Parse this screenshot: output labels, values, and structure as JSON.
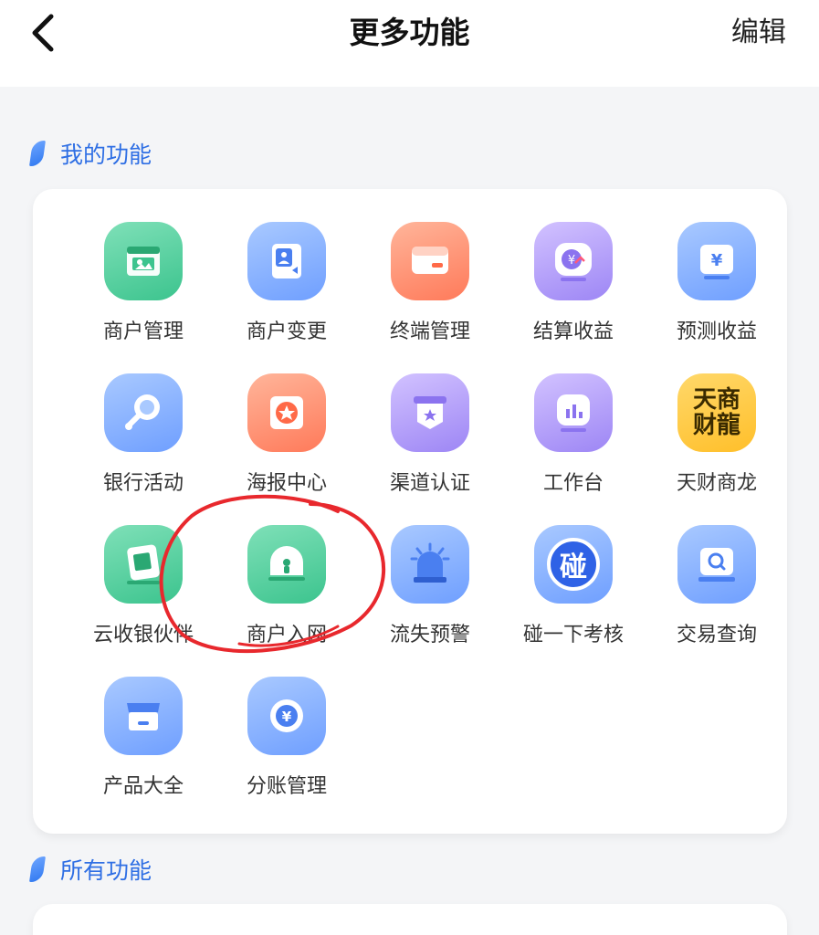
{
  "header": {
    "title": "更多功能",
    "edit_label": "编辑"
  },
  "sections": {
    "mine_title": "我的功能",
    "all_title": "所有功能"
  },
  "features": [
    {
      "label": "商户管理",
      "icon": "merchant-management-icon",
      "color": "green"
    },
    {
      "label": "商户变更",
      "icon": "merchant-change-icon",
      "color": "blue"
    },
    {
      "label": "终端管理",
      "icon": "terminal-management-icon",
      "color": "orange"
    },
    {
      "label": "结算收益",
      "icon": "settlement-income-icon",
      "color": "purple"
    },
    {
      "label": "预测收益",
      "icon": "forecast-income-icon",
      "color": "blue"
    },
    {
      "label": "银行活动",
      "icon": "bank-activity-icon",
      "color": "blue"
    },
    {
      "label": "海报中心",
      "icon": "poster-center-icon",
      "color": "orange"
    },
    {
      "label": "渠道认证",
      "icon": "channel-certification-icon",
      "color": "purple"
    },
    {
      "label": "工作台",
      "icon": "workbench-icon",
      "color": "purple"
    },
    {
      "label": "天财商龙",
      "icon": "tiancai-shanglong-logo",
      "color": "yellow",
      "logo_text": "天商财龍"
    },
    {
      "label": "云收银伙伴",
      "icon": "cloud-cashier-partner-icon",
      "color": "green"
    },
    {
      "label": "商户入网",
      "icon": "merchant-onboarding-icon",
      "color": "green"
    },
    {
      "label": "流失预警",
      "icon": "churn-alert-icon",
      "color": "blue"
    },
    {
      "label": "碰一下考核",
      "icon": "tap-assessment-icon",
      "color": "blue",
      "badge_text": "碰"
    },
    {
      "label": "交易查询",
      "icon": "transaction-query-icon",
      "color": "blue"
    },
    {
      "label": "产品大全",
      "icon": "product-catalog-icon",
      "color": "blue"
    },
    {
      "label": "分账管理",
      "icon": "split-account-icon",
      "color": "blue"
    }
  ],
  "colors": {
    "accent": "#2f6fe4",
    "annotation": "#e8282d"
  }
}
